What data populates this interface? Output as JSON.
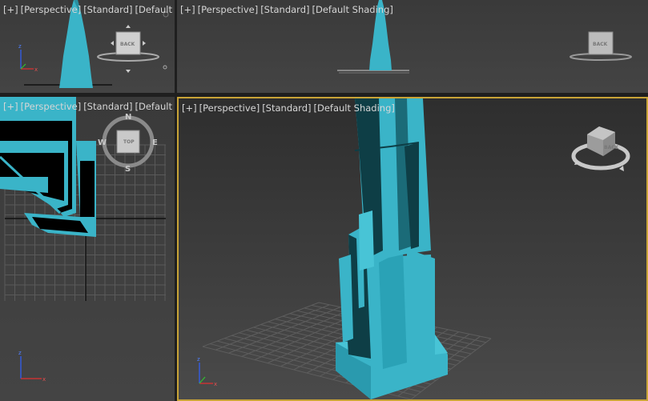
{
  "viewports": {
    "top_left": {
      "plus": "[+]",
      "view": "[Perspective]",
      "style": "[Standard]",
      "shading": "[Default Sha"
    },
    "top_right": {
      "plus": "[+]",
      "view": "[Perspective]",
      "style": "[Standard]",
      "shading": "[Default Shading]"
    },
    "bottom_left": {
      "plus": "[+]",
      "view": "[Perspective]",
      "style": "[Standard]",
      "shading": "[Default Sha"
    },
    "bottom_right": {
      "plus": "[+]",
      "view": "[Perspective]",
      "style": "[Standard]",
      "shading": "[Default Shading]"
    }
  },
  "viewcube": {
    "back_label": "BACK",
    "top_label": "TOP",
    "compass": {
      "north": "N",
      "south": "S",
      "east": "E",
      "west": "W"
    }
  },
  "axes": {
    "x": "x",
    "y": "y",
    "z": "z"
  },
  "colors": {
    "model": "#3ab4c8",
    "model_dark": "#0e3e46",
    "active_border": "#c9a437",
    "viewport_bg": "#404040"
  }
}
